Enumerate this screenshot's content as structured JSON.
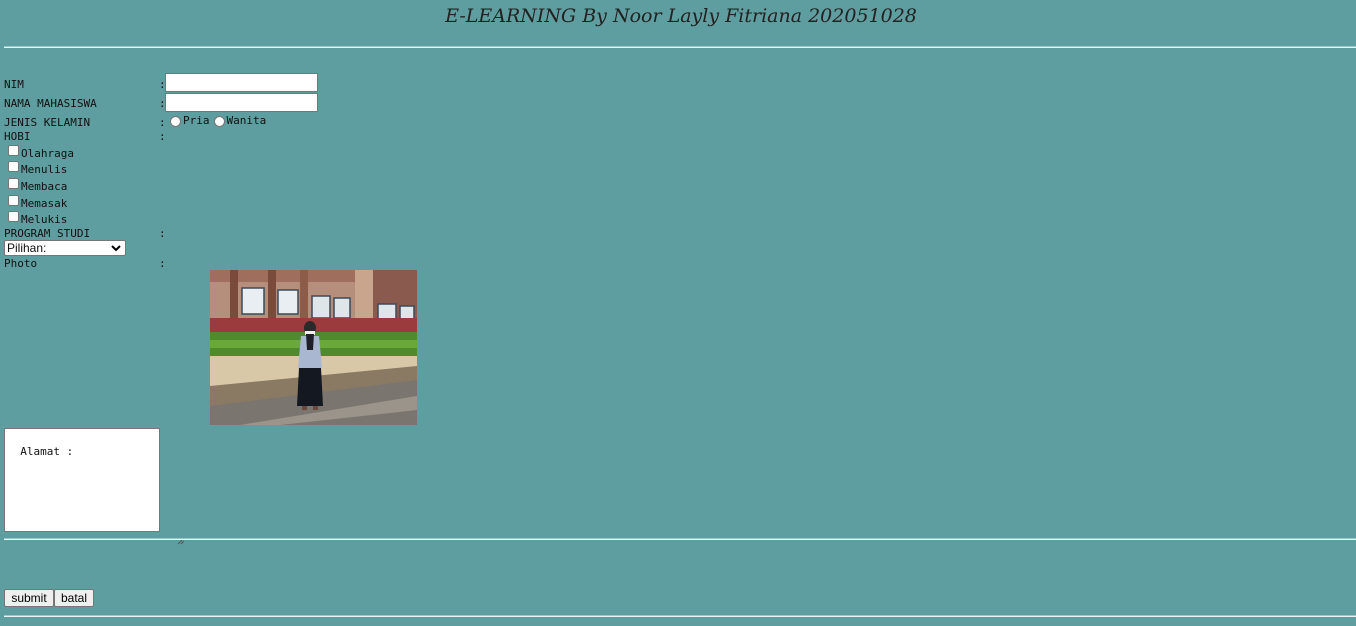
{
  "header": {
    "title": "E-LEARNING By Noor Layly Fitriana 202051028"
  },
  "form": {
    "colon": ":",
    "nim": {
      "label": "NIM",
      "value": ""
    },
    "nama": {
      "label": "NAMA MAHASISWA",
      "value": ""
    },
    "jenis_kelamin": {
      "label": "JENIS KELAMIN",
      "options": [
        "Pria",
        "Wanita"
      ]
    },
    "hobi": {
      "label": "HOBI",
      "options": [
        "Olahraga",
        "Menulis",
        "Membaca",
        "Memasak",
        "Melukis"
      ]
    },
    "program_studi": {
      "label": "PROGRAM STUDI",
      "selected": "Pilihan:"
    },
    "photo": {
      "label": "Photo"
    },
    "alamat": {
      "value": "Alamat :"
    }
  },
  "buttons": {
    "submit": "submit",
    "batal": "batal"
  },
  "colors": {
    "background": "#5f9ea0"
  }
}
